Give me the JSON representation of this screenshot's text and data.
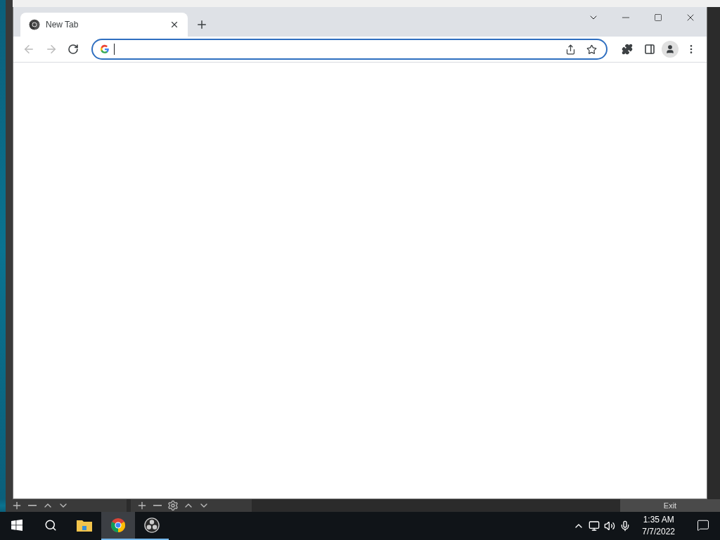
{
  "browser": {
    "tabs": [
      {
        "title": "New Tab",
        "selected": true
      }
    ],
    "address_bar": {
      "focused": true
    }
  },
  "background_app": {
    "exit_button": "Exit"
  },
  "taskbar": {
    "apps": [
      {
        "kind": "explorer",
        "selected": false,
        "running": false
      },
      {
        "kind": "chrome",
        "selected": true,
        "running": true
      },
      {
        "kind": "obs",
        "selected": false,
        "running": true
      }
    ],
    "clock": {
      "time": "1:35 AM",
      "date": "7/7/2022"
    }
  }
}
